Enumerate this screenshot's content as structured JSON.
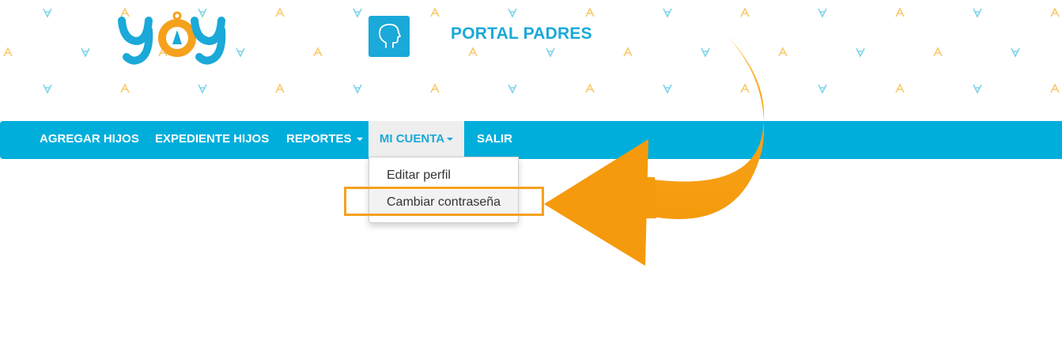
{
  "header": {
    "logo_text": "yoy",
    "portal_title": "PORTAL PADRES",
    "portal_icon": "head-profile-icon"
  },
  "nav": {
    "items": [
      {
        "label": "AGREGAR HIJOS"
      },
      {
        "label": "EXPEDIENTE HIJOS"
      },
      {
        "label": "REPORTES",
        "has_caret": true
      },
      {
        "label": "MI CUENTA",
        "has_caret": true,
        "active": true
      },
      {
        "label": "SALIR"
      }
    ]
  },
  "dropdown": {
    "items": [
      {
        "label": "Editar perfil"
      },
      {
        "label": "Cambiar contraseña",
        "highlighted": true
      }
    ]
  },
  "annotation": {
    "arrow_icon": "curved-arrow-icon",
    "highlight_color": "#f5a11d"
  },
  "colors": {
    "brand_blue": "#00aedb",
    "accent_orange": "#f5a11d",
    "pattern_yellow": "#f8c96a",
    "pattern_blue": "#7fd3ea"
  }
}
